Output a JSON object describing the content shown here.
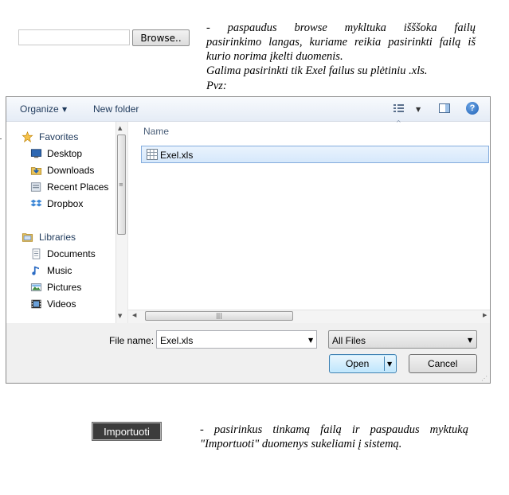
{
  "upload": {
    "browse_label": "Browse..",
    "note_lines": [
      "- paspaudus browse mykltuka išššoka failų",
      "pasirinkimo langas, kuriame reikia pasirinkti failą iš",
      "kurio norima įkelti duomenis.",
      "Galima pasirinkti tik Exel failus su plėtiniu .xls."
    ],
    "note_example": "Pvz:"
  },
  "dialog": {
    "toolbar": {
      "organize_label": "Organize",
      "new_folder_label": "New folder",
      "help_glyph": "?"
    },
    "nav": {
      "favorites": {
        "label": "Favorites",
        "items": [
          "Desktop",
          "Downloads",
          "Recent Places",
          "Dropbox"
        ]
      },
      "libraries": {
        "label": "Libraries",
        "items": [
          "Documents",
          "Music",
          "Pictures",
          "Videos"
        ]
      }
    },
    "content": {
      "column_name": "Name",
      "files": [
        "Exel.xls"
      ]
    },
    "file_name_label": "File name:",
    "file_name_value": "Exel.xls",
    "file_type_value": "All Files",
    "open_label": "Open",
    "cancel_label": "Cancel"
  },
  "import": {
    "button_label": "Importuoti",
    "note_lines": [
      "- pasirinkus tinkamą failą ir paspaudus myktuką",
      "\"Importuoti\" duomenys sukeliami į sistemą."
    ]
  },
  "colors": {
    "import_button_bg": "#3c3c3c",
    "selection_bg": "#d6e8fb",
    "selection_border": "#84acdd",
    "toolbar_text": "#1e395b"
  }
}
